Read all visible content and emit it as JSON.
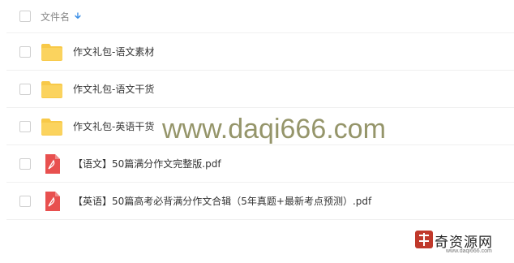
{
  "header": {
    "column_label": "文件名",
    "sort_icon": "arrow-down-icon"
  },
  "files": [
    {
      "type": "folder",
      "name": "作文礼包-语文素材"
    },
    {
      "type": "folder",
      "name": "作文礼包-语文干货"
    },
    {
      "type": "folder",
      "name": "作文礼包-英语干货"
    },
    {
      "type": "pdf",
      "name": "【语文】50篇满分作文完整版.pdf"
    },
    {
      "type": "pdf",
      "name": "【英语】50篇高考必背满分作文合辑（5年真题+最新考点预测）.pdf"
    }
  ],
  "watermark": "www.daqi666.com",
  "logo": {
    "text": "奇资源网",
    "url": "www.daqi666.com"
  },
  "colors": {
    "folder": "#f8c948",
    "pdf": "#e8504f",
    "sort_arrow": "#3a8ee6"
  }
}
